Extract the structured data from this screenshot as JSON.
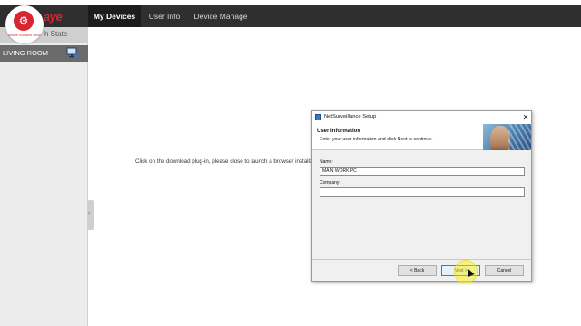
{
  "nav": {
    "tabs": [
      {
        "label": "My Devices",
        "active": true
      },
      {
        "label": "User Info",
        "active": false
      },
      {
        "label": "Device Manage",
        "active": false
      }
    ]
  },
  "logo": {
    "brand_text": "aye",
    "caption": "Mobile Solutions Clinic"
  },
  "sidebar": {
    "title": "h State",
    "device": "LIVING ROOM"
  },
  "main": {
    "plugin_message": "Click on the download plug-in, please close to launch a browser installed"
  },
  "dialog": {
    "title": "NetSurveillance Setup",
    "close_glyph": "✕",
    "heading": "User Information",
    "subheading": "Enter your user information and click Next to continue.",
    "name_label": "Name:",
    "name_value": "MAIN WORK PC",
    "company_label": "Company:",
    "company_value": "",
    "back_label": "< Back",
    "next_label": "Next >",
    "cancel_label": "Cancel"
  },
  "colors": {
    "navbar": "#2f2f2f",
    "brand_red": "#d7262f",
    "sidebar_device_row": "#6b6b6b",
    "cursor_highlight": "#fff200"
  },
  "icons": {
    "device_icon": "computer-monitor-icon",
    "close_icon": "close-icon",
    "title_icon": "setup-app-icon"
  }
}
